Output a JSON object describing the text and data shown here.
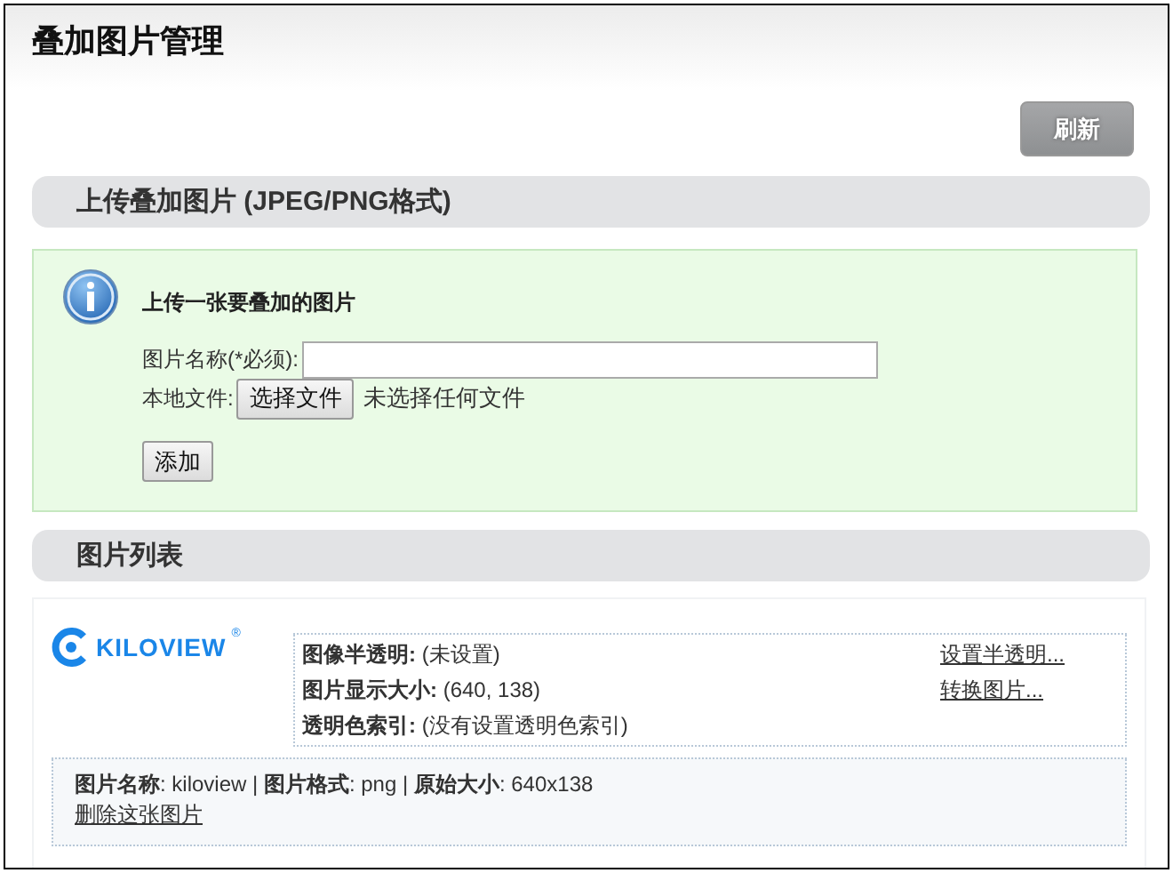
{
  "page": {
    "title": "叠加图片管理"
  },
  "refresh_button": "刷新",
  "upload": {
    "header": "上传叠加图片 (JPEG/PNG格式)",
    "intro": "上传一张要叠加的图片",
    "name_label": "图片名称(*必须):",
    "file_label": "本地文件:",
    "file_button": "选择文件",
    "file_status": "未选择任何文件",
    "add_button": "添加"
  },
  "list": {
    "header": "图片列表",
    "images": [
      {
        "thumbnail": {
          "text": "KILOVIEW",
          "mark": "®"
        },
        "properties": [
          {
            "label": "图像半透明:",
            "value": "(未设置)",
            "action": "设置半透明..."
          },
          {
            "label": "图片显示大小:",
            "value": "(640, 138)",
            "action": "转换图片..."
          },
          {
            "label": "透明色索引:",
            "value": "(没有设置透明色索引)"
          }
        ],
        "summary": "**图片名称**: kiloview | **图片格式**: png | **原始大小**: 640x138",
        "delete_link": "删除这张图片"
      }
    ]
  }
}
